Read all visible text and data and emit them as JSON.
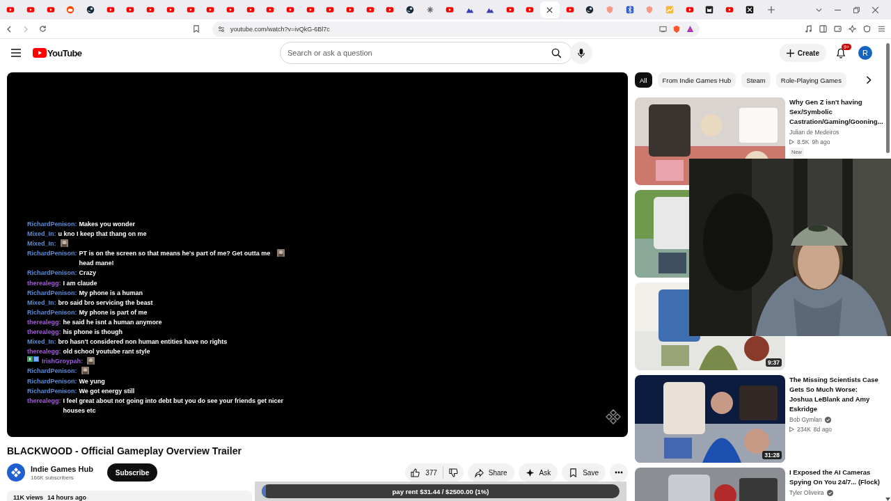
{
  "browser": {
    "tabs": [
      {
        "kind": "youtube",
        "selected": false
      },
      {
        "kind": "youtube",
        "selected": false
      },
      {
        "kind": "youtube",
        "selected": false
      },
      {
        "kind": "reddit",
        "selected": false
      },
      {
        "kind": "steam",
        "selected": false
      },
      {
        "kind": "youtube",
        "selected": false
      },
      {
        "kind": "youtube",
        "selected": false
      },
      {
        "kind": "youtube",
        "selected": false
      },
      {
        "kind": "youtube",
        "selected": false
      },
      {
        "kind": "youtube",
        "selected": false
      },
      {
        "kind": "youtube",
        "selected": false
      },
      {
        "kind": "youtube",
        "selected": false
      },
      {
        "kind": "youtube",
        "selected": false
      },
      {
        "kind": "youtube",
        "selected": false
      },
      {
        "kind": "youtube",
        "selected": false
      },
      {
        "kind": "youtube",
        "selected": false
      },
      {
        "kind": "youtube",
        "selected": false
      },
      {
        "kind": "youtube",
        "selected": false
      },
      {
        "kind": "youtube",
        "selected": false
      },
      {
        "kind": "youtube",
        "selected": false
      },
      {
        "kind": "steam",
        "selected": false
      },
      {
        "kind": "app",
        "selected": false
      },
      {
        "kind": "youtube",
        "selected": false
      },
      {
        "kind": "mountain",
        "selected": false
      },
      {
        "kind": "mountain",
        "selected": false
      },
      {
        "kind": "youtube",
        "selected": false
      },
      {
        "kind": "youtube",
        "selected": false
      },
      {
        "selected": true
      },
      {
        "kind": "youtube",
        "selected": false
      },
      {
        "kind": "steam",
        "selected": false
      },
      {
        "kind": "brave",
        "selected": false
      },
      {
        "kind": "bluetooth",
        "selected": false
      },
      {
        "kind": "brave",
        "selected": false
      },
      {
        "kind": "chart",
        "selected": false
      },
      {
        "kind": "youtube",
        "selected": false
      },
      {
        "kind": "cat",
        "selected": false
      },
      {
        "kind": "youtube",
        "selected": false
      },
      {
        "kind": "x",
        "selected": false
      }
    ],
    "url": "youtube.com/watch?v=ivQkG-6Bl7c"
  },
  "header": {
    "logo": "YouTube",
    "search": {
      "placeholder": "Search or ask a question"
    },
    "create": "Create",
    "notifications": "9+",
    "avatar": "R"
  },
  "player": {
    "chat": [
      {
        "user": "RichardPenison:",
        "color": "#5a8bd6",
        "text": "Makes you wonder"
      },
      {
        "user": "Mixed_In:",
        "color": "#5a8bd6",
        "text": "u kno I keep that thang on me"
      },
      {
        "user": "Mixed_In:",
        "color": "#5a8bd6",
        "emote": true
      },
      {
        "user": "RichardPenison:",
        "color": "#5a8bd6",
        "text": "PT is on the screen so that means he's part of me? Get outta me head mane!",
        "emote": true
      },
      {
        "user": "RichardPenison:",
        "color": "#5a8bd6",
        "text": "Crazy"
      },
      {
        "user": "therealegg:",
        "color": "#a35bdc",
        "text": "I am claude"
      },
      {
        "user": "RichardPenison:",
        "color": "#5a8bd6",
        "text": "My phone is a human"
      },
      {
        "user": "Mixed_In:",
        "color": "#5a8bd6",
        "text": "bro said bro servicing the beast"
      },
      {
        "user": "RichardPenison:",
        "color": "#5a8bd6",
        "text": "My phone is part of me"
      },
      {
        "user": "therealegg:",
        "color": "#a35bdc",
        "text": "he said he isnt a human anymore"
      },
      {
        "user": "therealegg:",
        "color": "#a35bdc",
        "text": "his phone is though"
      },
      {
        "user": "Mixed_In:",
        "color": "#5a8bd6",
        "text": "bro hasn't considered non human entities have no rights"
      },
      {
        "user": "therealegg:",
        "color": "#a35bdc",
        "text": "old school youtube rant style"
      },
      {
        "user": "IrishGroypah:",
        "color": "#9d5be0",
        "badges": true,
        "emote": true
      },
      {
        "user": "RichardPenison:",
        "color": "#5a8bd6",
        "emote": true
      },
      {
        "user": "RichardPenison:",
        "color": "#5a8bd6",
        "text": "We yung"
      },
      {
        "user": "RichardPenison:",
        "color": "#5a8bd6",
        "text": "We got energy still"
      },
      {
        "user": "therealegg:",
        "color": "#a35bdc",
        "text": "I feel great about not going into debt but you do see your friends get nicer houses etc"
      }
    ]
  },
  "video": {
    "title": "BLACKWOOD - Official Gameplay Overview Trailer",
    "channel": "Indie Games Hub",
    "subscribers": "166K subscribers",
    "subscribe": "Subscribe",
    "likes": "377",
    "actions": [
      {
        "kind": "share",
        "label": "Share"
      },
      {
        "kind": "ask",
        "label": "Ask"
      },
      {
        "kind": "save",
        "label": "Save"
      }
    ],
    "views": "11K views",
    "age": "14 hours ago"
  },
  "goal": {
    "text": "pay rent $31.44 / $2500.00 (1%)",
    "level": 0.0126
  },
  "chips": [
    {
      "label": "All",
      "selected": true
    },
    {
      "label": "From Indie Games Hub",
      "selected": false
    },
    {
      "label": "Steam",
      "selected": false
    },
    {
      "label": "Role-Playing Games",
      "selected": false
    }
  ],
  "recommendations": [
    {
      "thumbnail": {
        "kind": "picture"
      },
      "title": "Why Gen Z isn't having Sex/Symbolic Castration/Gaming/Gooning...",
      "channel": "Julian de Medeiros",
      "views": "8.5K",
      "age": "9h ago",
      "badge": "New"
    },
    {
      "thumbnail": {
        "kind": "picture"
      }
    },
    {
      "thumbnail": {
        "kind": "picture"
      },
      "duration": "9:37"
    },
    {
      "thumbnail": {
        "kind": "picture"
      },
      "duration": "31:28",
      "title": "The Missing Scientists Case Gets So Much Worse: Joshua LeBlank and Amy Eskridge",
      "channel": "Bob Gymlan",
      "verified": true,
      "views": "234K",
      "age": "8d ago"
    },
    {
      "thumbnail": {
        "kind": "picture"
      },
      "title": "I Exposed the AI Cameras Spying On You 24/7... (Flock)",
      "channel": "Tyler Oliveira",
      "verified": true
    }
  ],
  "webcam": {
    "kind": "picture"
  }
}
